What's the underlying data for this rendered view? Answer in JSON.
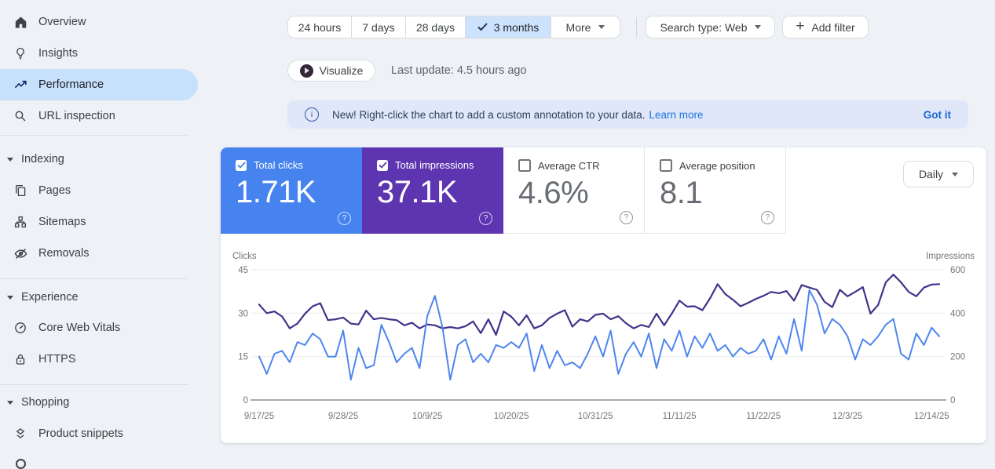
{
  "sidebar": {
    "items": [
      {
        "label": "Overview"
      },
      {
        "label": "Insights"
      },
      {
        "label": "Performance",
        "active": true
      },
      {
        "label": "URL inspection"
      }
    ],
    "sections": [
      {
        "header": "Indexing",
        "items": [
          {
            "label": "Pages"
          },
          {
            "label": "Sitemaps"
          },
          {
            "label": "Removals"
          }
        ]
      },
      {
        "header": "Experience",
        "items": [
          {
            "label": "Core Web Vitals"
          },
          {
            "label": "HTTPS"
          }
        ]
      },
      {
        "header": "Shopping",
        "items": [
          {
            "label": "Product snippets"
          }
        ]
      }
    ]
  },
  "toolbar": {
    "date_tabs": [
      {
        "label": "24 hours",
        "selected": false
      },
      {
        "label": "7 days",
        "selected": false
      },
      {
        "label": "28 days",
        "selected": false
      },
      {
        "label": "3 months",
        "selected": true
      },
      {
        "label": "More",
        "selected": false
      }
    ],
    "search_type_label": "Search type: Web",
    "add_filter_label": "Add filter",
    "visualize_label": "Visualize",
    "last_update": "Last update: 4.5 hours ago"
  },
  "banner": {
    "text": "New! Right-click the chart to add a custom annotation to your data.",
    "learn_more": "Learn more",
    "dismiss": "Got it"
  },
  "metrics": {
    "granularity": "Daily",
    "cards": [
      {
        "label": "Total clicks",
        "value": "1.71K",
        "checked": true,
        "color": "#4683ee"
      },
      {
        "label": "Total impressions",
        "value": "37.1K",
        "checked": true,
        "color": "#5e35b1"
      },
      {
        "label": "Average CTR",
        "value": "4.6%",
        "checked": false
      },
      {
        "label": "Average position",
        "value": "8.1",
        "checked": false
      }
    ]
  },
  "chart_data": {
    "type": "line",
    "left_axis": {
      "label": "Clicks",
      "max": 45,
      "ticks": [
        45,
        30,
        15,
        0
      ]
    },
    "right_axis": {
      "label": "Impressions",
      "max": 600,
      "ticks": [
        600,
        400,
        200,
        0
      ]
    },
    "x_ticks": [
      {
        "index": 0,
        "label": "9/17/25"
      },
      {
        "index": 11,
        "label": "9/28/25"
      },
      {
        "index": 22,
        "label": "10/9/25"
      },
      {
        "index": 33,
        "label": "10/20/25"
      },
      {
        "index": 44,
        "label": "10/31/25"
      },
      {
        "index": 55,
        "label": "11/11/25"
      },
      {
        "index": 66,
        "label": "11/22/25"
      },
      {
        "index": 77,
        "label": "12/3/25"
      },
      {
        "index": 88,
        "label": "12/14/25"
      }
    ],
    "series": [
      {
        "name": "Total clicks",
        "axis": "left",
        "color": "#4e86ee",
        "values": [
          15,
          9,
          16,
          17,
          13,
          20,
          19,
          23,
          21,
          15,
          15,
          24,
          7,
          18,
          11,
          12,
          26,
          20,
          13,
          16,
          18,
          11,
          29,
          36,
          25,
          7,
          19,
          21,
          13,
          16,
          13,
          19,
          18,
          20,
          18,
          23,
          10,
          19,
          11,
          17,
          12,
          13,
          11,
          16,
          22,
          15,
          24,
          9,
          16,
          20,
          15,
          23,
          11,
          21,
          17,
          24,
          15,
          22,
          18,
          23,
          17,
          19,
          15,
          18,
          16,
          17,
          21,
          14,
          22,
          16,
          28,
          17,
          38,
          33,
          23,
          28,
          26,
          22,
          14,
          21,
          19,
          22,
          26,
          28,
          16,
          14,
          23,
          19,
          25,
          22
        ]
      },
      {
        "name": "Total impressions",
        "axis": "right",
        "color": "#41338a",
        "values": [
          440,
          400,
          408,
          385,
          330,
          352,
          398,
          432,
          446,
          368,
          372,
          380,
          352,
          348,
          412,
          372,
          378,
          372,
          368,
          344,
          356,
          330,
          348,
          344,
          330,
          336,
          330,
          340,
          362,
          308,
          372,
          300,
          408,
          384,
          344,
          390,
          330,
          344,
          378,
          398,
          414,
          338,
          372,
          362,
          392,
          398,
          372,
          386,
          354,
          330,
          346,
          336,
          398,
          344,
          398,
          458,
          430,
          432,
          414,
          468,
          534,
          488,
          462,
          432,
          448,
          466,
          480,
          498,
          492,
          502,
          458,
          530,
          518,
          508,
          452,
          428,
          508,
          478,
          498,
          520,
          398,
          438,
          542,
          578,
          542,
          498,
          478,
          518,
          532,
          534
        ]
      }
    ],
    "grid": true,
    "legend_position": "none"
  }
}
